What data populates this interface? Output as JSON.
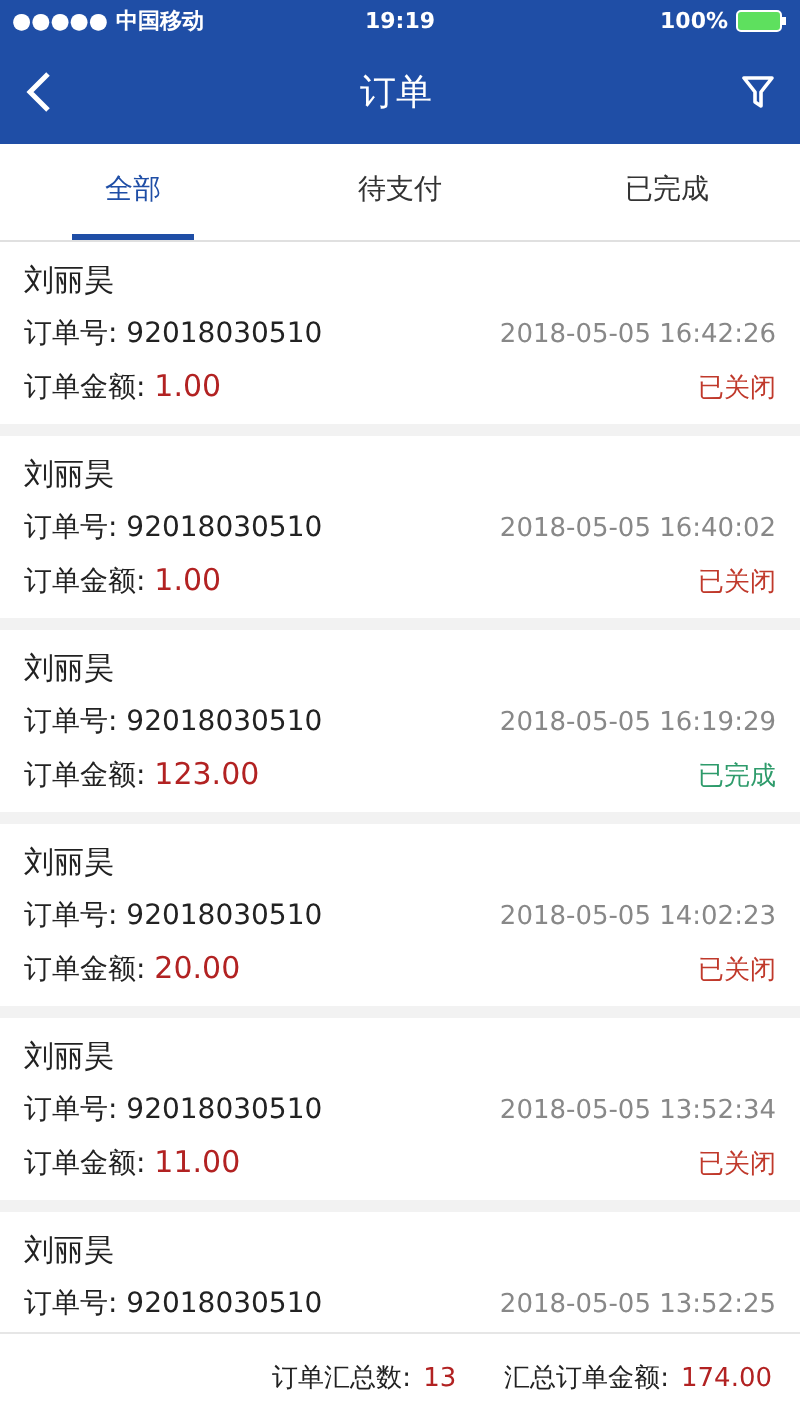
{
  "status_bar": {
    "carrier": "●●●●● 中国移动",
    "time": "19:19",
    "battery": "100%"
  },
  "nav": {
    "title": "订单"
  },
  "tabs": [
    {
      "label": "全部",
      "selected": true
    },
    {
      "label": "待支付",
      "selected": false
    },
    {
      "label": "已完成",
      "selected": false
    }
  ],
  "orders": [
    {
      "name": "刘丽昊",
      "order_label": "订单号:",
      "order_no": "92018030510",
      "time": "2018-05-05 16:42:26",
      "amount_label": "订单金额:",
      "amount": "1.00",
      "status": "已关闭",
      "kind": "closed"
    },
    {
      "name": "刘丽昊",
      "order_label": "订单号:",
      "order_no": "92018030510",
      "time": "2018-05-05 16:40:02",
      "amount_label": "订单金额:",
      "amount": "1.00",
      "status": "已关闭",
      "kind": "closed"
    },
    {
      "name": "刘丽昊",
      "order_label": "订单号:",
      "order_no": "92018030510",
      "time": "2018-05-05 16:19:29",
      "amount_label": "订单金额:",
      "amount": "123.00",
      "status": "已完成",
      "kind": "completed"
    },
    {
      "name": "刘丽昊",
      "order_label": "订单号:",
      "order_no": "92018030510",
      "time": "2018-05-05 14:02:23",
      "amount_label": "订单金额:",
      "amount": "20.00",
      "status": "已关闭",
      "kind": "closed"
    },
    {
      "name": "刘丽昊",
      "order_label": "订单号:",
      "order_no": "92018030510",
      "time": "2018-05-05 13:52:34",
      "amount_label": "订单金额:",
      "amount": "11.00",
      "status": "已关闭",
      "kind": "closed"
    },
    {
      "name": "刘丽昊",
      "order_label": "订单号:",
      "order_no": "92018030510",
      "time": "2018-05-05 13:52:25"
    }
  ],
  "footer": {
    "count_label": "订单汇总数:",
    "count": "13",
    "total_label": "汇总订单金额:",
    "total": "174.00"
  }
}
